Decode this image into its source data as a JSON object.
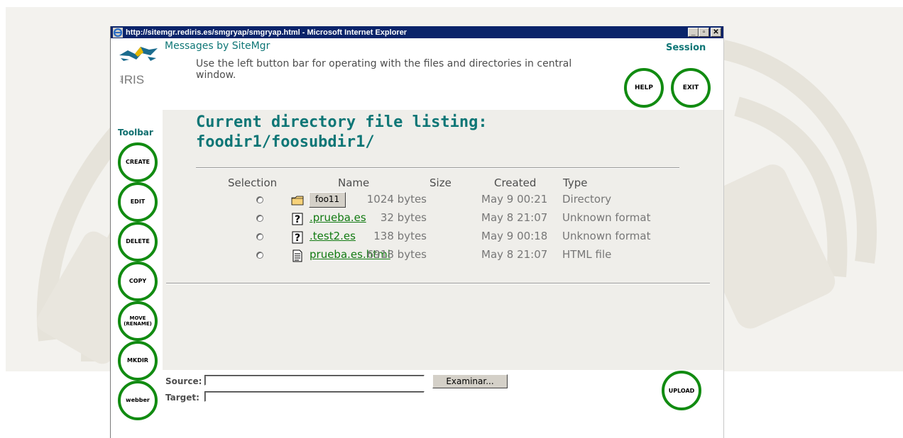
{
  "window": {
    "title": "http://sitemgr.rediris.es/smgryap/smgryap.html - Microsoft Internet Explorer",
    "minimize": "_",
    "maximize": "▫",
    "close": "✕"
  },
  "logo": {
    "text": "IRIS",
    "small": "Red"
  },
  "toolbar": {
    "label": "Toolbar",
    "buttons": [
      "CREATE",
      "EDIT",
      "DELETE",
      "COPY",
      "MOVE\n(RENAME)",
      "MKDIR",
      "webber"
    ]
  },
  "messages": {
    "title": "Messages by SiteMgr",
    "text": "Use the left button bar for operating with the files and directories in central window.",
    "session": "Session",
    "help": "HELP",
    "exit": "EXIT"
  },
  "listing": {
    "heading_line1": "Current directory file listing:",
    "heading_line2": "foodir1/foosubdir1/",
    "columns": [
      "Selection",
      "Name",
      "Size",
      "Created",
      "Type"
    ],
    "rows": [
      {
        "name": "foo11",
        "size": "1024 bytes",
        "created": "May 9 00:21",
        "type": "Directory",
        "icon": "folder-icon"
      },
      {
        "name": ".prueba.es",
        "size": "32 bytes",
        "created": "May 8 21:07",
        "type": "Unknown format",
        "icon": "unknown-file-icon"
      },
      {
        "name": ".test2.es",
        "size": "138 bytes",
        "created": "May 9 00:18",
        "type": "Unknown format",
        "icon": "unknown-file-icon"
      },
      {
        "name": "prueba.es.html",
        "size": "6918 bytes",
        "created": "May 8 21:07",
        "type": "HTML file",
        "icon": "text-file-icon"
      }
    ]
  },
  "upload": {
    "source_label": "Source:",
    "target_label": "Target:",
    "source_value": "",
    "target_value": "",
    "browse_label": "Examinar...",
    "upload_label": "UPLOAD"
  },
  "colors": {
    "accent": "#0e7676",
    "button_ring": "#118b11",
    "link": "#117a11"
  }
}
